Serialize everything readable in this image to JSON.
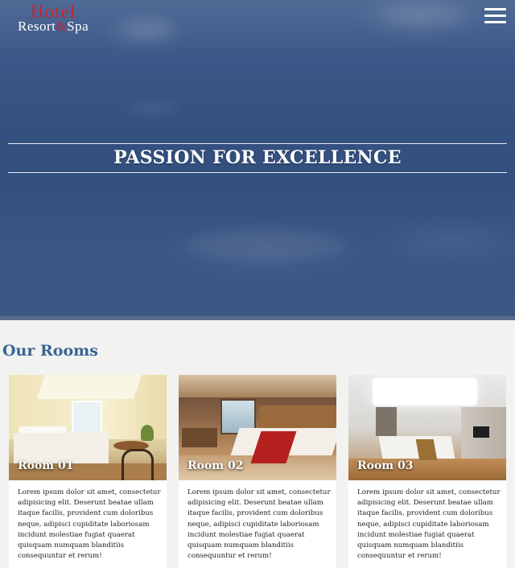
{
  "header": {
    "logo_top": "Hotel",
    "logo_bottom_left": "Resort",
    "logo_amp": "&",
    "logo_bottom_right": "Spa",
    "menu_icon": "hamburger-menu-icon"
  },
  "hero": {
    "tagline": "PASSION FOR EXCELLENCE"
  },
  "rooms": {
    "title": "Our Rooms",
    "items": [
      {
        "name": "Room 01",
        "text": "Lorem ipsum dolor sit amet, consectetur adipisicing elit. Deserunt beatae ullam itaque facilis, provident cum doloribus neque, adipisci cupiditate laboriosam incidunt molestiae fugiat quaerat quisquam numquam blanditiis consequuntur et rerum!"
      },
      {
        "name": "Room 02",
        "text": "Lorem ipsum dolor sit amet, consectetur adipisicing elit. Deserunt beatae ullam itaque facilis, provident cum doloribus neque, adipisci cupiditate laboriosam incidunt molestiae fugiat quaerat quisquam numquam blanditiis consequuntur et rerum!"
      },
      {
        "name": "Room 03",
        "text": "Lorem ipsum dolor sit amet, consectetur adipisicing elit. Deserunt beatae ullam itaque facilis, provident cum doloribus neque, adipisci cupiditate laboriosam incidunt molestiae fugiat quaerat quisquam numquam blanditiis consequuntur et rerum!"
      }
    ]
  },
  "colors": {
    "brand_red": "#c7233a",
    "heading_blue": "#3a6596",
    "hero_blue": "#34507f"
  }
}
